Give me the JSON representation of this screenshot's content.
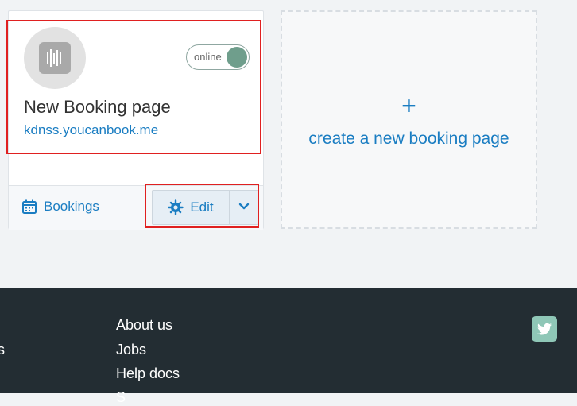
{
  "booking_card": {
    "status_toggle": {
      "label": "online",
      "state": "on"
    },
    "title": "New Booking page",
    "url": "kdnss.youcanbook.me",
    "footer": {
      "bookings_label": "Bookings",
      "edit_label": "Edit"
    }
  },
  "create_card": {
    "plus": "+",
    "label": "create a new booking page"
  },
  "footer": {
    "left_fragment": "s",
    "links": [
      "About us",
      "Jobs",
      "Help docs",
      "S"
    ]
  },
  "colors": {
    "accent": "#1a7dc2",
    "toggle_knob": "#6f9e8c",
    "footer_bg": "#232d33",
    "highlight": "#e02020"
  },
  "icons": {
    "avatar": "booking-page-logo-icon",
    "bookings": "calendar-icon",
    "edit": "gear-icon",
    "dropdown": "chevron-down-icon",
    "social": "twitter-icon"
  }
}
